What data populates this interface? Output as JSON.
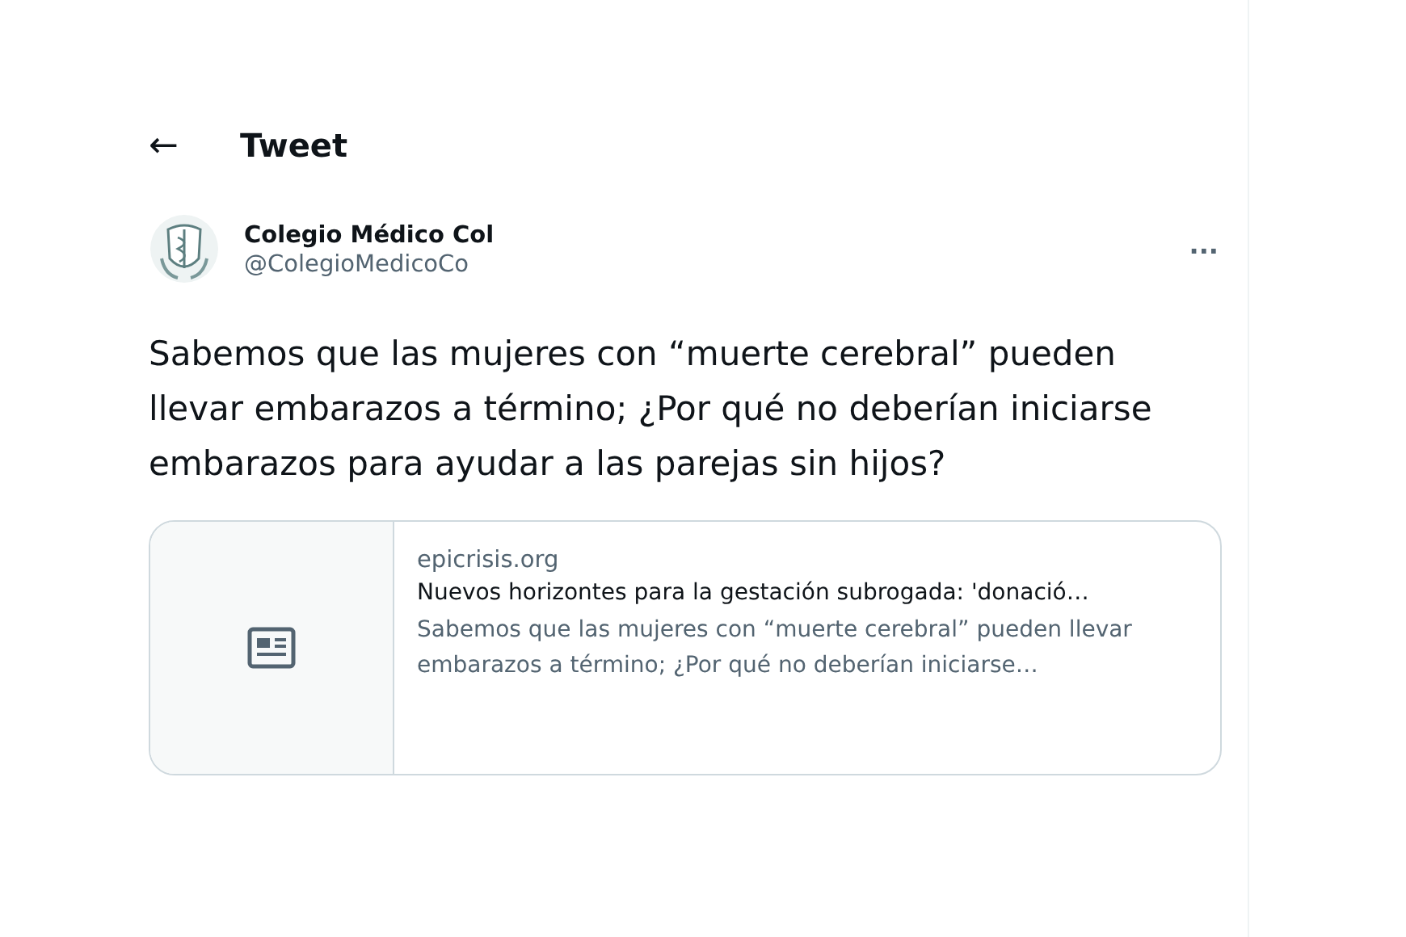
{
  "header": {
    "back": "←",
    "title": "Tweet"
  },
  "author": {
    "name": "Colegio Médico Col",
    "handle": "@ColegioMedicoCo",
    "more": "···"
  },
  "text": "Sabemos que las mujeres con “muerte cerebral” pueden llevar embarazos a término; ¿Por qué no deberían iniciarse embarazos para ayudar a las parejas sin hijos?",
  "card": {
    "domain": "epicrisis.org",
    "title": "Nuevos horizontes para la gestación subrogada: 'donació…",
    "description": "Sabemos que las mujeres con “muerte cerebral” pueden llevar embarazos a término; ¿Por qué no deberían iniciarse…"
  }
}
